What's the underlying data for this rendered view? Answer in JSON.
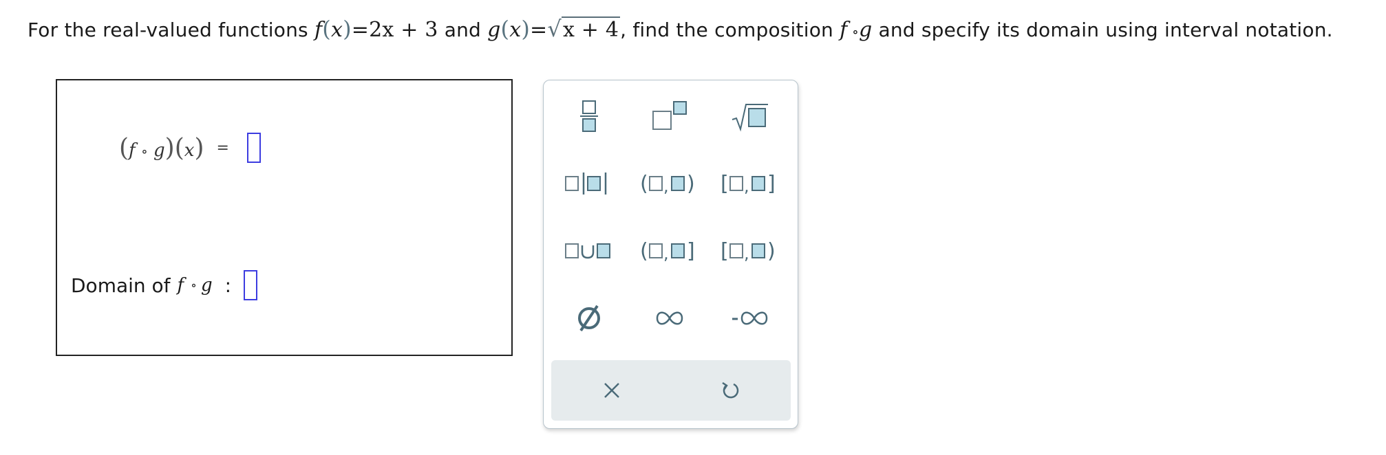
{
  "question": {
    "part1": "For the real-valued functions ",
    "f_name": "f",
    "x": "x",
    "f_def": "2x + 3",
    "and": " and ",
    "g_name": "g",
    "g_radicand": "x + 4",
    "part2": ", find the composition ",
    "comp_f": "f",
    "comp_op": " ∘",
    "comp_g": "g",
    "part3": " and specify its domain using interval notation."
  },
  "answer": {
    "comp_lhs": {
      "f": "f",
      "op": "∘",
      "g": "g",
      "x": "x"
    },
    "equals": "=",
    "domain_label": "Domain of",
    "domain_f": "f",
    "domain_op": "∘",
    "domain_g": "g",
    "colon": ":"
  },
  "palette": {
    "buttons": [
      {
        "id": "fraction",
        "label": "fraction"
      },
      {
        "id": "exponent",
        "label": "exponent"
      },
      {
        "id": "sqrt",
        "label": "square root"
      },
      {
        "id": "abs",
        "label": "absolute value"
      },
      {
        "id": "open-open",
        "label": "(□,□)"
      },
      {
        "id": "closed-closed",
        "label": "[□,□]"
      },
      {
        "id": "union",
        "label": "union"
      },
      {
        "id": "open-closed",
        "label": "(□,□]"
      },
      {
        "id": "closed-open",
        "label": "[□,□)"
      },
      {
        "id": "empty-set",
        "label": "Ø"
      },
      {
        "id": "infinity",
        "label": "∞"
      },
      {
        "id": "neg-infinity",
        "label": "-∞"
      }
    ],
    "clear_label": "×",
    "undo_label": "↺",
    "accent": "#4a6a78",
    "fill": "#b9dde9"
  }
}
